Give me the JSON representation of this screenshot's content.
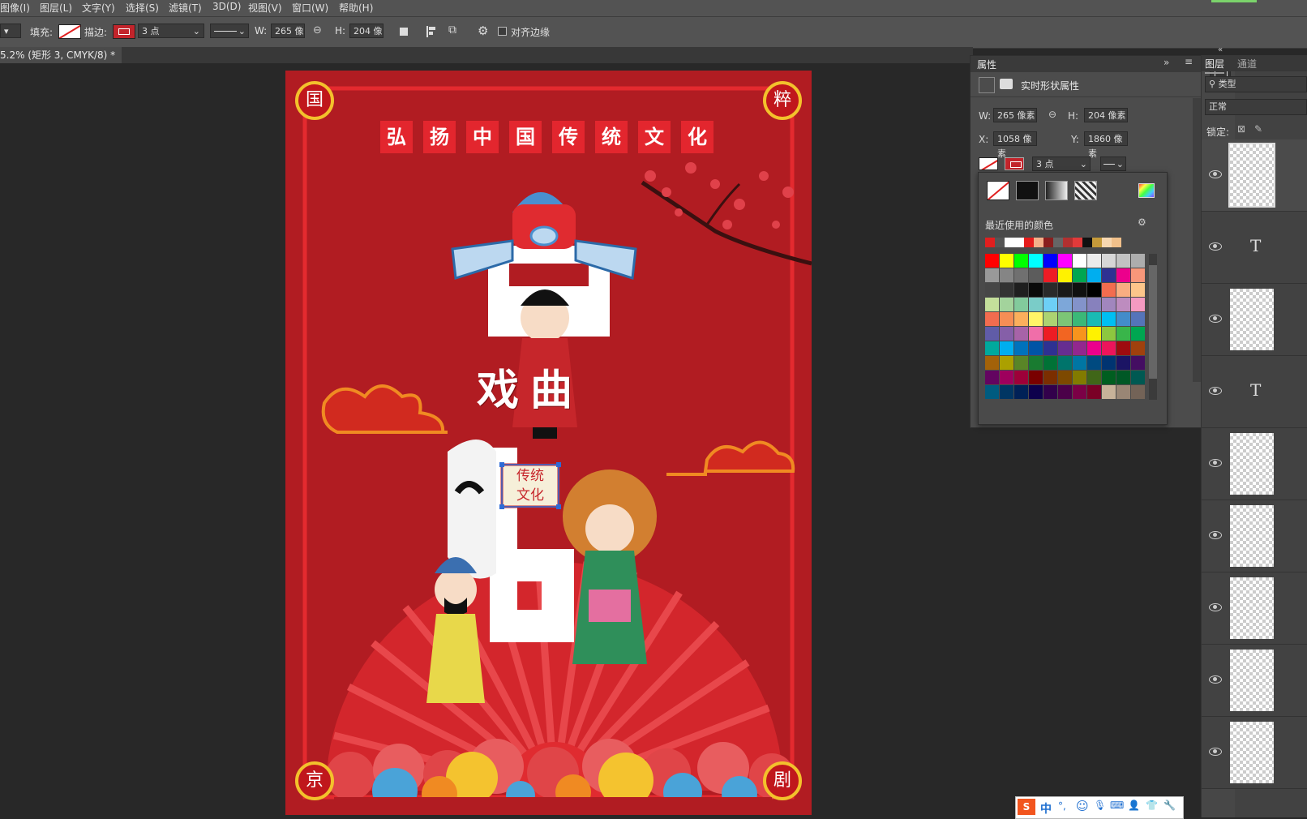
{
  "menu": [
    "图像(I)",
    "图层(L)",
    "文字(Y)",
    "选择(S)",
    "滤镜(T)",
    "3D(D)",
    "视图(V)",
    "窗口(W)",
    "帮助(H)"
  ],
  "options": {
    "fill_label": "填充:",
    "stroke_label": "描边:",
    "stroke_width": "3 点",
    "w_label": "W:",
    "w_value": "265 像",
    "h_label": "H:",
    "h_value": "204 像",
    "align_edges": "对齐边缘"
  },
  "document_tab": {
    "title": "5.2% (矩形 3, CMYK/8) *",
    "close": "×"
  },
  "poster": {
    "slogan": [
      "弘",
      "扬",
      "中",
      "国",
      "传",
      "统",
      "文",
      "化"
    ],
    "corners": {
      "top_left": "国",
      "top_right": "粹",
      "bottom_left": "京",
      "bottom_right": "剧"
    },
    "xiqu": "戏曲",
    "stamp_lines": [
      "传统",
      "文化"
    ],
    "colors": {
      "background": "#b11c22",
      "border": "#e42a2f",
      "gold": "#f3c12c"
    }
  },
  "properties": {
    "title": "属性",
    "subtitle": "实时形状属性",
    "w_label": "W:",
    "w_value": "265 像素",
    "h_label": "H:",
    "h_value": "204 像素",
    "x_label": "X:",
    "x_value": "1058 像素",
    "y_label": "Y:",
    "y_value": "1860 像素",
    "stroke_width": "3 点"
  },
  "picker": {
    "recent_label": "最近使用的颜色",
    "recent": [
      "#e11f1f",
      "#555555",
      "#ffffff",
      "#ffffff",
      "#e51c1c",
      "#f4b08a",
      "#8a1e1e",
      "#666666",
      "#b23030",
      "#e23a3a",
      "#111111",
      "#c59a3a",
      "#f7d7b0",
      "#f1c08a"
    ],
    "grid": [
      [
        "#ff0000",
        "#ffff00",
        "#00ff00",
        "#00ffff",
        "#0000ff",
        "#ff00ff",
        "#ffffff",
        "#ebebeb",
        "#d6d6d6",
        "#c2c2c2",
        "#adadad"
      ],
      [
        "#999999",
        "#858585",
        "#707070",
        "#5c5c5c",
        "#ee1c25",
        "#fff200",
        "#00a650",
        "#00aeef",
        "#2e3192",
        "#ec008c",
        "#f7977a"
      ],
      [
        "#474747",
        "#333333",
        "#1f1f1f",
        "#0a0a0a",
        "#2a2a2a",
        "#1a1a1a",
        "#101010",
        "#000000",
        "#f26c4f",
        "#f9ad81",
        "#fdc68a"
      ],
      [
        "#c4df9b",
        "#a3d39c",
        "#82ca9c",
        "#7accc8",
        "#6dcff6",
        "#7da7d9",
        "#8393ca",
        "#8781bd",
        "#a186be",
        "#bd8cbf",
        "#f49ac1"
      ],
      [
        "#f26c4f",
        "#f68e55",
        "#fbaf5c",
        "#fff467",
        "#acd372",
        "#7cc576",
        "#3bb878",
        "#1abbb4",
        "#00bff3",
        "#438cca",
        "#5574b9"
      ],
      [
        "#605ca8",
        "#855fa8",
        "#a763a8",
        "#f06ea9",
        "#ed1c24",
        "#f26522",
        "#f7941d",
        "#fff200",
        "#8dc73f",
        "#39b54a",
        "#00a651"
      ],
      [
        "#00a99d",
        "#00aeef",
        "#0072bc",
        "#0054a6",
        "#2e3192",
        "#662d91",
        "#92278f",
        "#ec008c",
        "#ed145b",
        "#9e0b0f",
        "#a0410d"
      ],
      [
        "#a36209",
        "#aba000",
        "#598527",
        "#197b30",
        "#007236",
        "#00746b",
        "#0076a3",
        "#004a80",
        "#003471",
        "#1b1464",
        "#440e62"
      ],
      [
        "#630460",
        "#9e005d",
        "#9e0039",
        "#790000",
        "#7b2e00",
        "#7d4900",
        "#827b00",
        "#406618",
        "#005e20",
        "#005826",
        "#005952"
      ],
      [
        "#005b7f",
        "#003663",
        "#002157",
        "#0d004c",
        "#32004b",
        "#4b0049",
        "#7b0046",
        "#7a0026",
        "#c7b299",
        "#998675",
        "#736357"
      ]
    ]
  },
  "layers_panel": {
    "tab_layers": "图层",
    "tab_channels": "通道",
    "filter_kind": "类型",
    "blend_mode": "正常",
    "lock_label": "锁定:",
    "rows": [
      "",
      "T",
      "",
      "T",
      "",
      "",
      "",
      "",
      ""
    ]
  },
  "ime": {
    "logo": "S",
    "lang": "中"
  }
}
